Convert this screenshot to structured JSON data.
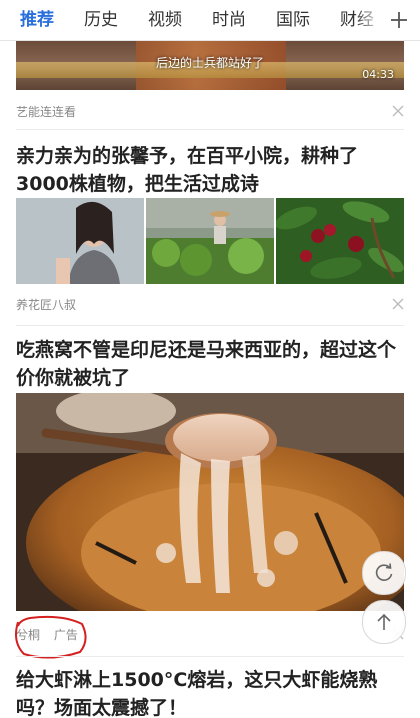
{
  "tabs": [
    {
      "label": "推荐",
      "active": true
    },
    {
      "label": "历史",
      "active": false
    },
    {
      "label": "视频",
      "active": false
    },
    {
      "label": "时尚",
      "active": false
    },
    {
      "label": "国际",
      "active": false
    },
    {
      "label": "财经",
      "active": false
    }
  ],
  "tab_add_icon": "plus-icon",
  "accent_color": "#2a6fdb",
  "feed": {
    "video": {
      "caption": "后边的士兵都站好了",
      "duration": "04:33",
      "source": "艺能连连看"
    },
    "article1": {
      "title": "亲力亲为的张馨予，在百平小院，耕种了3000株植物，把生活过成诗",
      "source": "养花匠八叔"
    },
    "ad": {
      "title": "吃燕窝不管是印尼还是马来西亚的，超过这个价你就被坑了",
      "source": "兮桐",
      "ad_label": "广告"
    },
    "article3": {
      "title": "给大虾淋上1500°C熔岩，这只大虾能烧熟吗？场面太震撼了！"
    }
  },
  "floating": {
    "refresh_icon": "refresh-icon",
    "top_icon": "arrow-up-icon"
  },
  "annotation_color": "#d42020"
}
